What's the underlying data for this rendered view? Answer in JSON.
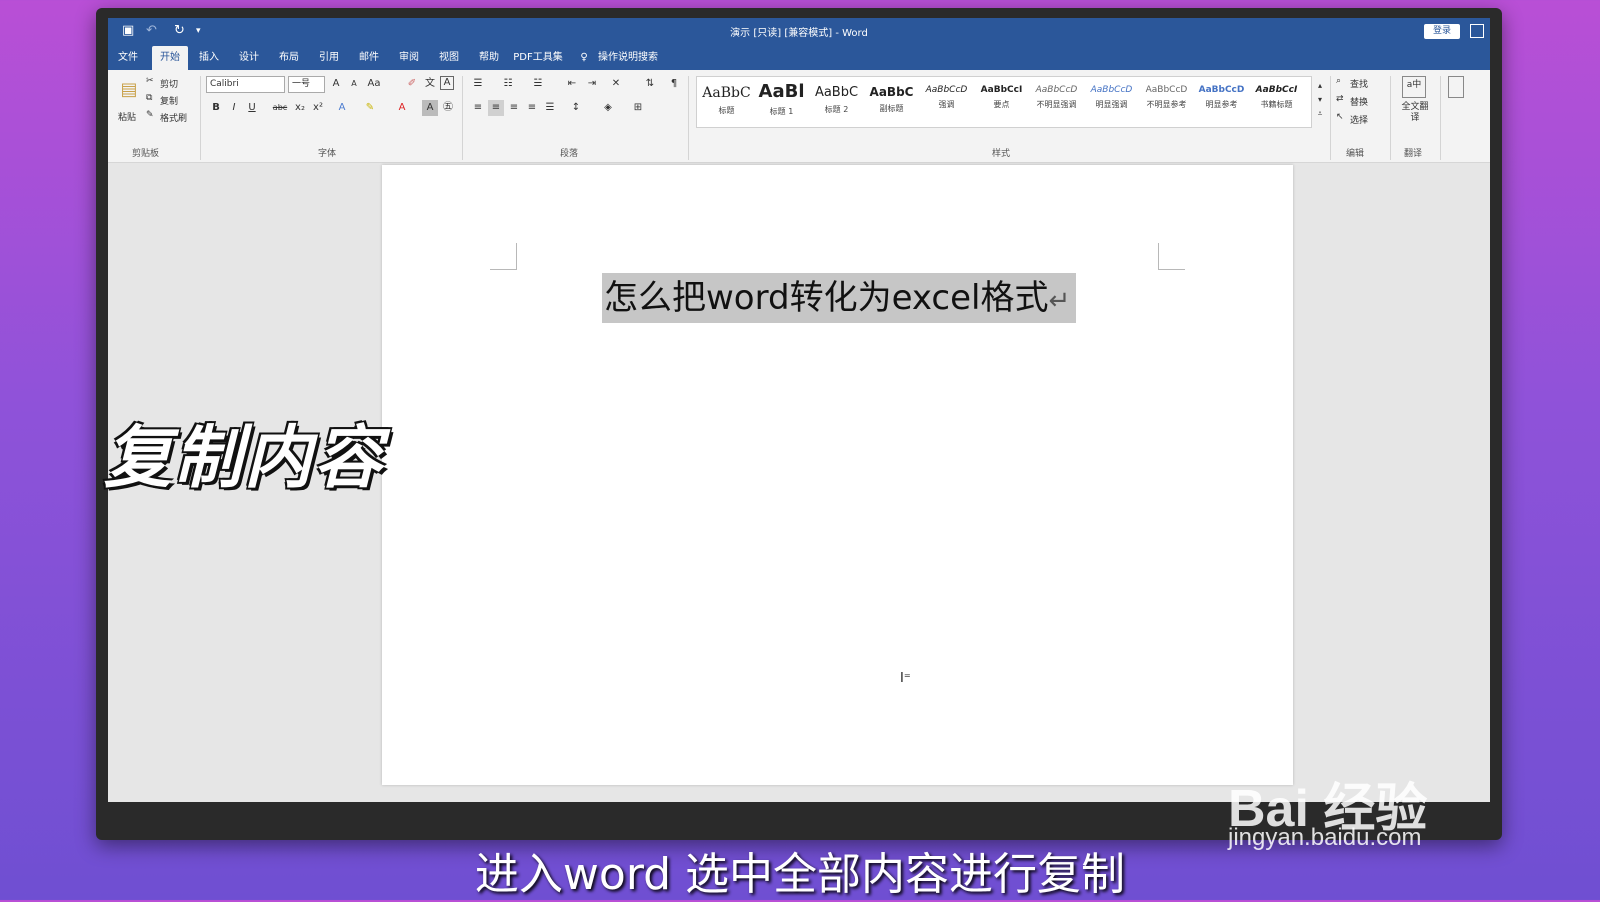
{
  "window": {
    "title": "演示 [只读] [兼容模式] - Word",
    "login_label": "登录"
  },
  "tabs": [
    {
      "label": "文件"
    },
    {
      "label": "开始"
    },
    {
      "label": "插入"
    },
    {
      "label": "设计"
    },
    {
      "label": "布局"
    },
    {
      "label": "引用"
    },
    {
      "label": "邮件"
    },
    {
      "label": "审阅"
    },
    {
      "label": "视图"
    },
    {
      "label": "帮助"
    },
    {
      "label": "PDF工具集"
    },
    {
      "label": "操作说明搜索"
    }
  ],
  "clipboard": {
    "paste": "粘贴",
    "cut": "剪切",
    "copy": "复制",
    "format_painter": "格式刷",
    "group": "剪贴板"
  },
  "font": {
    "name": "Calibri",
    "size": "一号",
    "group": "字体"
  },
  "paragraph": {
    "group": "段落"
  },
  "styles": {
    "group": "样式",
    "items": [
      {
        "preview": "AaBbC",
        "name": "标题"
      },
      {
        "preview": "AaBl",
        "name": "标题 1"
      },
      {
        "preview": "AaBbC",
        "name": "标题 2"
      },
      {
        "preview": "AaBbC",
        "name": "副标题"
      },
      {
        "preview": "AaBbCcD",
        "name": "强调"
      },
      {
        "preview": "AaBbCcI",
        "name": "要点"
      },
      {
        "preview": "AaBbCcD",
        "name": "不明显强调"
      },
      {
        "preview": "AaBbCcD",
        "name": "明显强调"
      },
      {
        "preview": "AaBbCcD",
        "name": "不明显参考"
      },
      {
        "preview": "AaBbCcD",
        "name": "明显参考"
      },
      {
        "preview": "AaBbCcI",
        "name": "书籍标题"
      }
    ]
  },
  "editing": {
    "find": "查找",
    "replace": "替换",
    "select": "选择",
    "group": "编辑"
  },
  "translate": {
    "button": "全文翻译",
    "group": "翻译"
  },
  "document": {
    "text": "怎么把word转化为excel格式",
    "para_mark": "↵"
  },
  "overlay": {
    "caption": "复制内容"
  },
  "subtitle": {
    "text": "进入word 选中全部内容进行复制"
  },
  "watermark": {
    "brand": "Bai 经验",
    "url": "jingyan.baidu.com"
  }
}
